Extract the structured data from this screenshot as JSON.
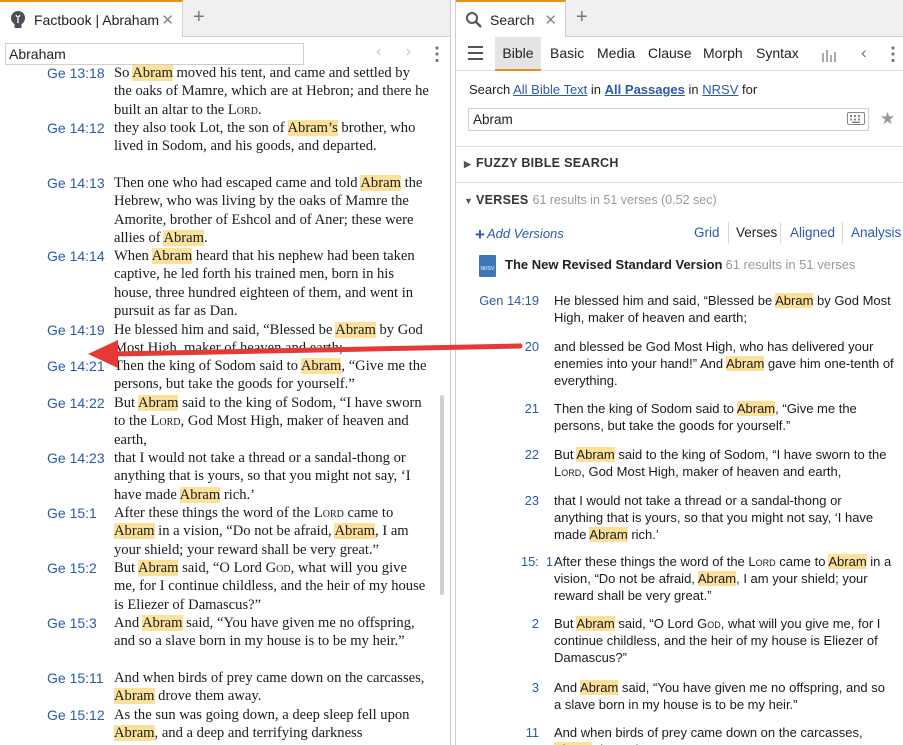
{
  "left": {
    "tab_title": "Factbook | Abraham",
    "tab_close": "✕",
    "tab_add": "+",
    "ref_value": "Abraham",
    "nav": "‹ ›",
    "kebab": "⋮",
    "verses": [
      {
        "ref": "Ge 13:18",
        "html": "So <span class=\"hl\">Abram</span> moved his tent, and came and settled by the oaks of Mamre, which are at Hebron; and there he built an altar to the <span class=\"sc\">Lord</span>."
      },
      {
        "ref": "Ge 14:12",
        "html": "they also took Lot, the son of <span class=\"hl\">Abram’s</span> brother, who lived in Sodom, and his goods, and departed."
      },
      {
        "ref": "Ge 14:13",
        "html": "Then one who had escaped came and told <span class=\"hl\">Abram</span> the Hebrew, who was living by the oaks of Mamre the Amorite, brother of Eshcol and of Aner; these were allies of <span class=\"hl\">Abram</span>."
      },
      {
        "ref": "Ge 14:14",
        "html": "When <span class=\"hl\">Abram</span> heard that his nephew had been taken captive, he led forth his trained men, born in his house, three hundred eighteen of them, and went in pursuit as far as Dan."
      },
      {
        "ref": "Ge 14:19",
        "html": "He blessed him and said, “Blessed be <span class=\"hl\">Abram</span> by God Most High, maker of heaven and earth;"
      },
      {
        "ref": "Ge 14:21",
        "html": "Then the king of Sodom said to <span class=\"hl\">Abram</span>, “Give me the persons, but take the goods for yourself.”"
      },
      {
        "ref": "Ge 14:22",
        "html": "But <span class=\"hl\">Abram</span> said to the king of Sodom, “I have sworn to the <span class=\"sc\">Lord</span>, God Most High, maker of heaven and earth,"
      },
      {
        "ref": "Ge 14:23",
        "html": "that I would not take a thread or a sandal-thong or anything that is yours, so that you might not say, ‘I have made <span class=\"hl\">Abram</span> rich.’"
      },
      {
        "ref": "Ge 15:1",
        "html": "After these things the word of the <span class=\"sc\">Lord</span> came to <span class=\"hl\">Abram</span> in a vision, “Do not be afraid, <span class=\"hl\">Abram</span>, I am your shield; your reward shall be very great.”"
      },
      {
        "ref": "Ge 15:2",
        "html": "But <span class=\"hl\">Abram</span> said, “O Lord <span class=\"sc\">God</span>, what will you give me, for I continue childless, and the heir of my house is Eliezer of Damascus?”"
      },
      {
        "ref": "Ge 15:3",
        "html": "And <span class=\"hl\">Abram</span> said, “You have given me no offspring, and so a slave born in my house is to be my heir.”"
      },
      {
        "ref": "Ge 15:11",
        "html": "And when birds of prey came down on the carcasses, <span class=\"hl\">Abram</span> drove them away."
      },
      {
        "ref": "Ge 15:12",
        "html": "As the sun was going down, a deep sleep fell upon <span class=\"hl\">Abram</span>, and a deep and terrifying darkness"
      }
    ]
  },
  "right": {
    "tab_title": "Search",
    "tab_close": "✕",
    "tab_add": "+",
    "search_types": [
      "Bible",
      "Basic",
      "Media",
      "Clause",
      "Morph",
      "Syntax"
    ],
    "chevron": "‹",
    "kebab": "⋮",
    "search_in": {
      "prefix": "Search",
      "what": "All Bible Text",
      "in1": "in",
      "range": "All Passages",
      "in2": "in",
      "version": "NRSV",
      "suffix": "for"
    },
    "query": "Abram",
    "star": "★",
    "fuzzy_label": "FUZZY BIBLE SEARCH",
    "verses_label": "VERSES",
    "verses_meta": "61 results in 51 verses (0.52 sec)",
    "add_versions": "Add Versions",
    "view_tabs": [
      "Grid",
      "Verses",
      "Aligned",
      "Analysis"
    ],
    "version_name": "The New Revised Standard Version",
    "version_meta": "61 results in 51 verses",
    "book_icon_label": "NRSV",
    "results": [
      {
        "ref": "Gen 14:19",
        "html": "He blessed him and said, “Blessed be <span class=\"hl\">Abram</span> by God Most High, maker of heaven and earth;"
      },
      {
        "ref": "20",
        "html": "and blessed be God Most High, who has delivered your enemies into your hand!” And <span class=\"hl\">Abram</span> gave him one-tenth of everything."
      },
      {
        "ref": "21",
        "html": "Then the king of Sodom said to <span class=\"hl\">Abram</span>, “Give me the persons, but take the goods for yourself.”"
      },
      {
        "ref": "22",
        "html": "But <span class=\"hl\">Abram</span> said to the king of Sodom, “I have sworn to the <span class=\"sc\">Lord</span>, God Most High, maker of heaven and earth,"
      },
      {
        "ref": "23",
        "html": "that I would not take a thread or a sandal-thong or anything that is yours, so that you might not say, ‘I have made <span class=\"hl\">Abram</span> rich.’"
      },
      {
        "ref": "15:  1",
        "html": "After these things the word of the <span class=\"sc\">Lord</span> came to <span class=\"hl\">Abram</span> in a vision, “Do not be afraid, <span class=\"hl\">Abram</span>, I am your shield; your reward shall be very great.”"
      },
      {
        "ref": "2",
        "html": "But <span class=\"hl\">Abram</span> said, “O Lord <span class=\"sc\">God</span>, what will you give me, for I continue childless, and the heir of my house is Eliezer of Damascus?”"
      },
      {
        "ref": "3",
        "html": "And <span class=\"hl\">Abram</span> said, “You have given me no offspring, and so a slave born in my house is to be my heir.”"
      },
      {
        "ref": "11",
        "html": "And when birds of prey came down on the carcasses, <span class=\"hl\">Abram</span> drove them away."
      }
    ]
  },
  "colors": {
    "accent": "#f08c1a",
    "link": "#2a5aa8",
    "highlight": "#fbe19a",
    "arrow": "#e53935"
  }
}
